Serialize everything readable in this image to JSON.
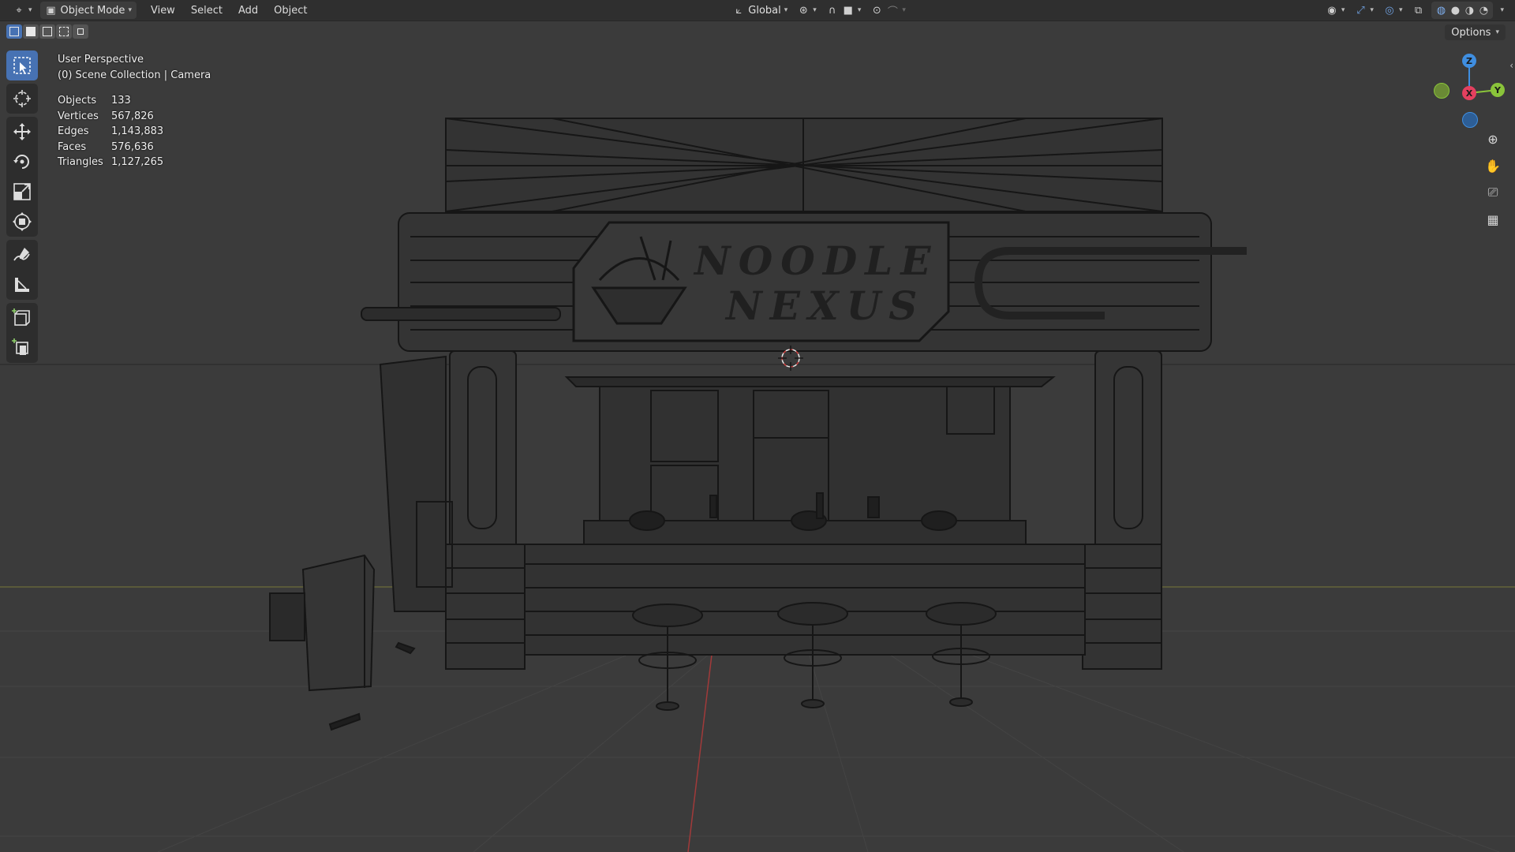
{
  "header": {
    "mode_label": "Object Mode",
    "menus": [
      "View",
      "Select",
      "Add",
      "Object"
    ],
    "transform_orientation": "Global"
  },
  "viewport": {
    "perspective_label": "User Perspective",
    "collection_label": "(0) Scene Collection | Camera",
    "options_label": "Options"
  },
  "stats": [
    {
      "label": "Objects",
      "value": "133"
    },
    {
      "label": "Vertices",
      "value": "567,826"
    },
    {
      "label": "Edges",
      "value": "1,143,883"
    },
    {
      "label": "Faces",
      "value": "576,636"
    },
    {
      "label": "Triangles",
      "value": "1,127,265"
    }
  ],
  "sign": {
    "line1": "NOODLE",
    "line2": "NEXUS"
  },
  "gizmo": {
    "z_label": "Z",
    "x_label": "X",
    "y_label": "Y"
  },
  "tools": [
    {
      "name": "select-box-icon",
      "active": true
    },
    {
      "name": "cursor-icon"
    },
    {
      "name": "move-icon"
    },
    {
      "name": "rotate-icon"
    },
    {
      "name": "scale-icon"
    },
    {
      "name": "transform-icon"
    },
    {
      "name": "annotate-icon"
    },
    {
      "name": "measure-icon"
    },
    {
      "name": "add-cube-icon"
    },
    {
      "name": "add-object-icon"
    }
  ],
  "colors": {
    "accent": "#4772b3",
    "axis_x": "#e4405f",
    "axis_y": "#8ac43a",
    "axis_z": "#3f8ee0",
    "wire": "#1a1a1a"
  }
}
